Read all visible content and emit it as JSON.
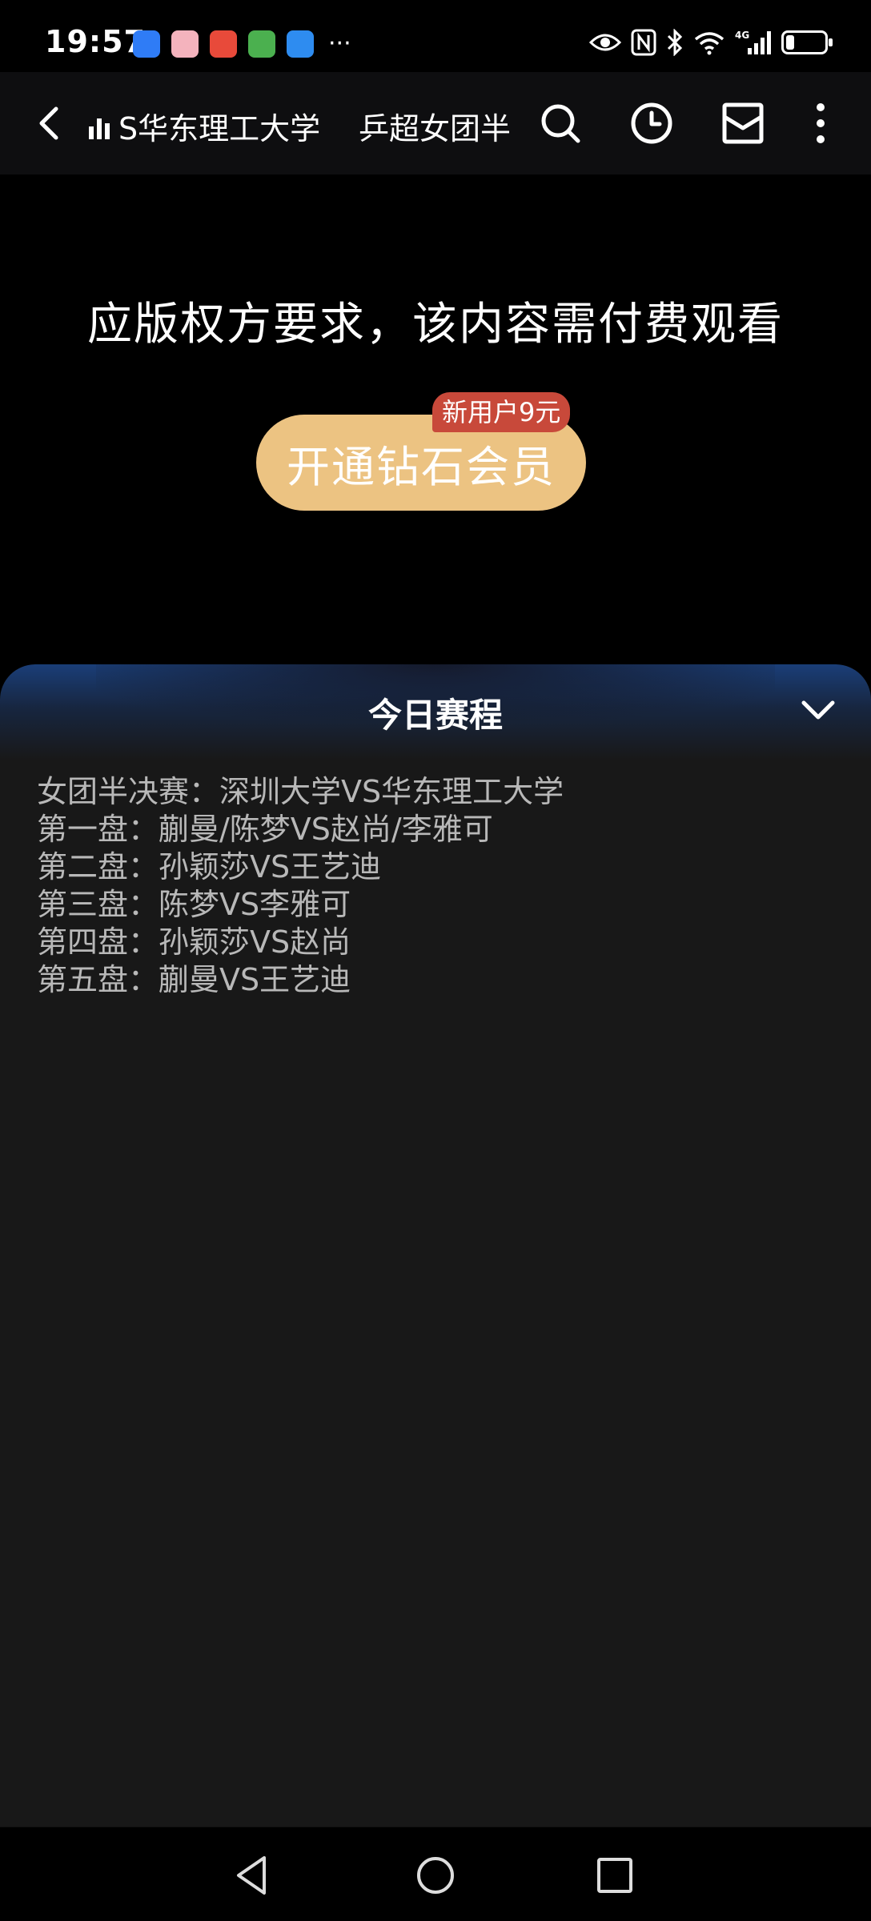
{
  "status_bar": {
    "time": "19:57",
    "notification_icons": [
      {
        "name": "shield-app-icon",
        "color": "#2f7cf6"
      },
      {
        "name": "cake-app-icon",
        "color": "#f4b3bd"
      },
      {
        "name": "emoji-app-icon",
        "color": "#e84a3a"
      },
      {
        "name": "game-app-icon",
        "color": "#4bb04f"
      },
      {
        "name": "cloud-app-icon",
        "color": "#2e8cf0"
      }
    ],
    "more_indicator": "···",
    "network_label": "4G",
    "battery_level": 0.2
  },
  "header": {
    "channel_title": "S华东理工大学",
    "match_title": "乒超女团半"
  },
  "player": {
    "paywall_message": "应版权方要求，该内容需付费观看",
    "vip_button_label": "开通钻石会员",
    "promo_badge": "新用户9元"
  },
  "schedule": {
    "title": "今日赛程",
    "lines": [
      "女团半决赛：深圳大学VS华东理工大学",
      "第一盘：蒯曼/陈梦VS赵尚/李雅可",
      "第二盘：孙颖莎VS王艺迪",
      "第三盘：陈梦VS李雅可",
      "第四盘：孙颖莎VS赵尚",
      "第五盘：蒯曼VS王艺迪"
    ]
  },
  "colors": {
    "vip_button": "#ecc382",
    "promo_badge": "#c8493a",
    "sheet_bg": "#181818",
    "sheet_glow": "#1a3e78"
  }
}
